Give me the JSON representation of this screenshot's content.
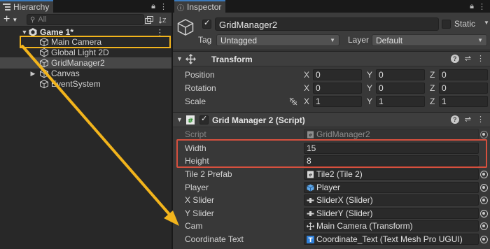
{
  "hierarchy": {
    "tab_label": "Hierarchy",
    "search_placeholder": "All",
    "scene": {
      "name": "Game 1*"
    },
    "items": [
      {
        "name": "Main Camera"
      },
      {
        "name": "Global Light 2D"
      },
      {
        "name": "GridManager2"
      },
      {
        "name": "Canvas"
      },
      {
        "name": "EventSystem"
      }
    ]
  },
  "inspector": {
    "tab_label": "Inspector",
    "object_name": "GridManager2",
    "static_label": "Static",
    "tag_label": "Tag",
    "tag_value": "Untagged",
    "layer_label": "Layer",
    "layer_value": "Default",
    "transform": {
      "title": "Transform",
      "position": {
        "label": "Position",
        "x": "0",
        "y": "0",
        "z": "0"
      },
      "rotation": {
        "label": "Rotation",
        "x": "0",
        "y": "0",
        "z": "0"
      },
      "scale": {
        "label": "Scale",
        "x": "1",
        "y": "1",
        "z": "1"
      },
      "axis_x": "X",
      "axis_y": "Y",
      "axis_z": "Z"
    },
    "script_component": {
      "title": "Grid Manager 2 (Script)",
      "script_label": "Script",
      "script_value": "GridManager2",
      "width_label": "Width",
      "width_value": "15",
      "height_label": "Height",
      "height_value": "8",
      "tile_prefab_label": "Tile 2 Prefab",
      "tile_prefab_value": "Tile2 (Tile 2)",
      "player_label": "Player",
      "player_value": "Player",
      "x_slider_label": "X Slider",
      "x_slider_value": "SliderX (Slider)",
      "y_slider_label": "Y Slider",
      "y_slider_value": "SliderY (Slider)",
      "cam_label": "Cam",
      "cam_value": "Main Camera (Transform)",
      "coord_text_label": "Coordinate Text",
      "coord_text_value": "Coordinate_Text (Text Mesh Pro UGUI)"
    }
  },
  "colors": {
    "highlight_box": "#d6503e",
    "selection_box": "#f2b41c",
    "arrow": "#f2b41c",
    "tab_accent": "#3a79bb"
  }
}
